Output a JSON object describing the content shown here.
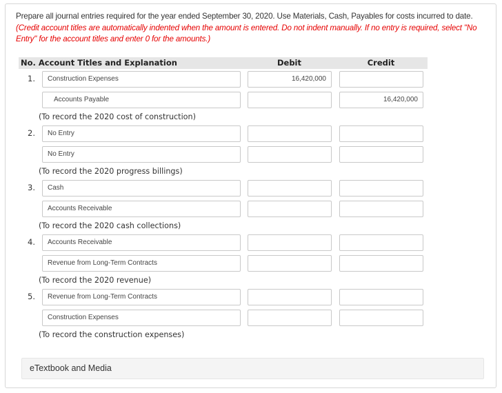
{
  "instructions": {
    "main": "Prepare all journal entries required for the year ended September 30, 2020. Use Materials, Cash, Payables for costs incurred to date.",
    "note": "(Credit account titles are automatically indented when the amount is entered. Do not indent manually. If no entry is required, select \"No Entry\" for the account titles and enter 0 for the amounts.)"
  },
  "table": {
    "headers": {
      "no_account": "No. Account Titles and Explanation",
      "debit": "Debit",
      "credit": "Credit"
    },
    "entries": [
      {
        "number": "1.",
        "lines": [
          {
            "account": "Construction Expenses",
            "debit": "16,420,000",
            "credit": ""
          },
          {
            "account": "Accounts Payable",
            "debit": "",
            "credit": "16,420,000"
          }
        ],
        "explanation": "(To record the 2020 cost of construction)"
      },
      {
        "number": "2.",
        "lines": [
          {
            "account": "No Entry",
            "debit": "",
            "credit": ""
          },
          {
            "account": "No Entry",
            "debit": "",
            "credit": ""
          }
        ],
        "explanation": "(To record the 2020 progress billings)"
      },
      {
        "number": "3.",
        "lines": [
          {
            "account": "Cash",
            "debit": "",
            "credit": ""
          },
          {
            "account": "Accounts Receivable",
            "debit": "",
            "credit": ""
          }
        ],
        "explanation": "(To record the 2020 cash collections)"
      },
      {
        "number": "4.",
        "lines": [
          {
            "account": "Accounts Receivable",
            "debit": "",
            "credit": ""
          },
          {
            "account": "Revenue from Long-Term Contracts",
            "debit": "",
            "credit": ""
          }
        ],
        "explanation": "(To record the 2020 revenue)"
      },
      {
        "number": "5.",
        "lines": [
          {
            "account": "Revenue from Long-Term Contracts",
            "debit": "",
            "credit": ""
          },
          {
            "account": "Construction Expenses",
            "debit": "",
            "credit": ""
          }
        ],
        "explanation": "(To record the construction expenses)"
      }
    ]
  },
  "footer": {
    "etextbook_label": "eTextbook and Media"
  },
  "colors": {
    "note_red": "#e60000",
    "header_bg": "#e6e6e6",
    "border": "#c8c8c8"
  }
}
